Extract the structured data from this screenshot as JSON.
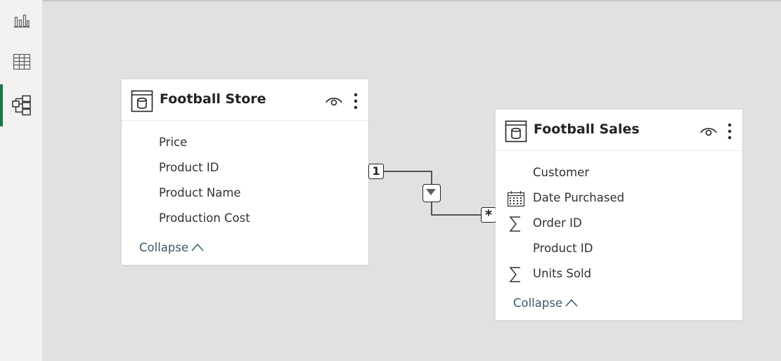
{
  "nav": {
    "items": [
      {
        "icon": "report-view-icon",
        "label": "Report"
      },
      {
        "icon": "data-view-icon",
        "label": "Data"
      },
      {
        "icon": "model-view-icon",
        "label": "Model",
        "active": true
      }
    ],
    "accent": "#217346"
  },
  "tables": [
    {
      "title": "Football Store",
      "fields": [
        {
          "name": "Price",
          "icon": ""
        },
        {
          "name": "Product ID",
          "icon": ""
        },
        {
          "name": "Product Name",
          "icon": ""
        },
        {
          "name": "Production Cost",
          "icon": ""
        }
      ],
      "collapse_label": "Collapse"
    },
    {
      "title": "Football Sales",
      "fields": [
        {
          "name": "Customer",
          "icon": ""
        },
        {
          "name": "Date Purchased",
          "icon": "calendar-icon"
        },
        {
          "name": "Order ID",
          "icon": "sigma-icon"
        },
        {
          "name": "Product ID",
          "icon": ""
        },
        {
          "name": "Units Sold",
          "icon": "sigma-icon"
        }
      ],
      "collapse_label": "Collapse"
    }
  ],
  "relationship": {
    "from": "Football Store",
    "to": "Football Sales",
    "from_cardinality": "1",
    "to_cardinality": "*",
    "filter_icon": "filter-direction-icon"
  },
  "colors": {
    "canvas": "#e2e1e0",
    "card": "#ffffff",
    "collapse_text": "#3b5a6a"
  }
}
